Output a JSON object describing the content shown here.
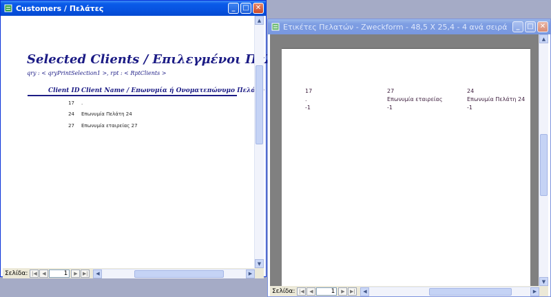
{
  "window1": {
    "title": "Customers / Πελάτες",
    "report": {
      "title": "Selected Clients / Επιλεγμένοι Πελάτες",
      "subtitle": "qry : < qryPrintSelection1 >,  rpt : < RptClients >",
      "col_id": "Client ID",
      "col_name": "Client Name / Επωνυμία ή Ονοματεπώνυμο Πελάτη",
      "rows": [
        {
          "id": "17",
          "name": "."
        },
        {
          "id": "24",
          "name": "Επωνυμία Πελάτη 24"
        },
        {
          "id": "27",
          "name": "Επωνυμία εταιρείας 27"
        }
      ]
    },
    "nav": {
      "label": "Σελίδα:",
      "page": "1"
    }
  },
  "window2": {
    "title": "Ετικέτες Πελατών - Zweckform - 48,5 X 25,4 - 4 ανά σειρά",
    "labels": [
      {
        "id": "17",
        "name": ".",
        "val": "-1"
      },
      {
        "id": "27",
        "name": "Επωνυμία εταιρείας",
        "val": "-1"
      },
      {
        "id": "24",
        "name": "Επωνυμία Πελάτη 24",
        "val": "-1"
      }
    ],
    "nav": {
      "label": "Σελίδα:",
      "page": "1"
    }
  },
  "colors": {
    "accent": "#0a5be9",
    "report_text": "#1b1b85",
    "desktop": "#a5abc6"
  }
}
